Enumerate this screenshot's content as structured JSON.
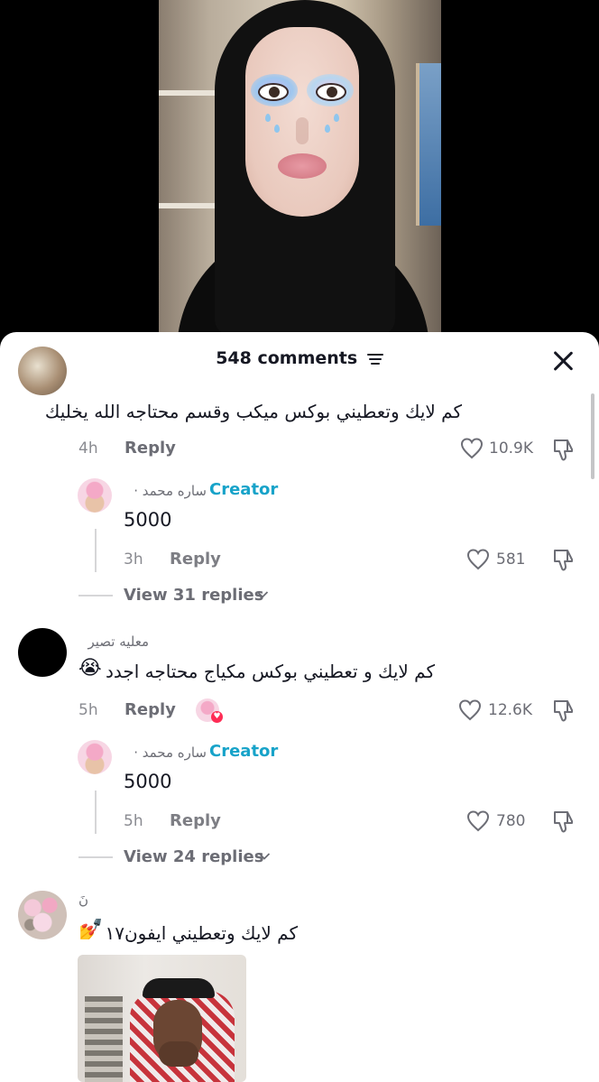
{
  "header": {
    "comment_count": "548 comments",
    "sort_icon": "sort-lines-icon",
    "close_icon": "close-icon"
  },
  "colors": {
    "creator": "#17a3c9",
    "text": "#161823",
    "muted": "#6c6d75",
    "like_badge": "#fe2c55"
  },
  "comments": [
    {
      "username": "",
      "text": "كم لايك وتعطيني بوكس ميكب وقسم محتاجه الله يخليك",
      "time": "4h",
      "reply_label": "Reply",
      "likes": "10.9K",
      "creator_reply": {
        "tag": "Creator",
        "name": "ساره محمد ·",
        "text": "5000",
        "time": "3h",
        "reply_label": "Reply",
        "likes": "581"
      },
      "view_replies": "View 31 replies"
    },
    {
      "username": "معليه تصير",
      "text": "كم لايك و تعطيني بوكس مكياج محتاجه اجدد",
      "emoji": "😭",
      "time": "5h",
      "reply_label": "Reply",
      "likes": "12.6K",
      "creator_reply": {
        "tag": "Creator",
        "name": "ساره محمد ·",
        "text": "5000",
        "time": "5h",
        "reply_label": "Reply",
        "likes": "780"
      },
      "view_replies": "View 24 replies"
    },
    {
      "username": "نَ",
      "text": "كم لايك وتعطيني ايفون١٧",
      "emoji": "💅"
    }
  ]
}
